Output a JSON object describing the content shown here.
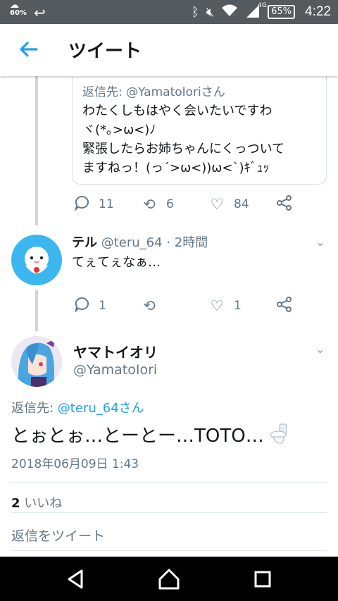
{
  "status_bar": {
    "weather_temp": "60%",
    "network": "4G",
    "battery": "65%",
    "time": "4:22"
  },
  "app_bar": {
    "title": "ツイート"
  },
  "quoted_tweet": {
    "reply_to": "返信先: @YamatoIoriさん",
    "text_lines": [
      "わたくしもはやく会いたいですわ",
      "ヾ(*｡>ω<)ﾉ",
      "緊張したらお姉ちゃんにくっついて",
      "ますねっ！(っ´>ω<))ω<`)ｷﾞｭｯ"
    ],
    "replies": "11",
    "retweets": "6",
    "likes": "84"
  },
  "reply_tweet": {
    "name": "テル",
    "handle_time": "@teru_64 · 2時間",
    "text": "てぇてぇなぁ…",
    "replies": "1",
    "retweets": "",
    "likes": "1"
  },
  "main_tweet": {
    "name": "ヤマトイオリ",
    "handle": "@YamatoIori",
    "reply_prefix": "返信先: ",
    "reply_user": "@teru_64さん",
    "text": "とぉとぉ…とーとー…TOTO…",
    "date": "2018年06月09日 1:43",
    "likes_count": "2",
    "likes_label": "いいね"
  },
  "reply_input": {
    "placeholder": "返信をツイート"
  },
  "colors": {
    "accent": "#1da1f2",
    "secondary_text": "#657786",
    "statusbar": "#555a5f"
  }
}
